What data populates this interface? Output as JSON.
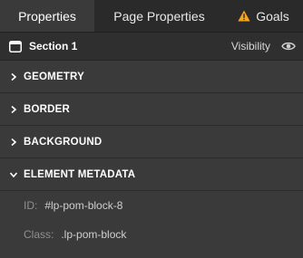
{
  "tabs": [
    {
      "label": "Properties"
    },
    {
      "label": "Page Properties"
    },
    {
      "label": "Goals"
    }
  ],
  "section": {
    "title": "Section 1",
    "visibility_label": "Visibility"
  },
  "accordion": [
    {
      "label": "GEOMETRY",
      "expanded": false
    },
    {
      "label": "BORDER",
      "expanded": false
    },
    {
      "label": "BACKGROUND",
      "expanded": false
    },
    {
      "label": "ELEMENT METADATA",
      "expanded": true
    }
  ],
  "metadata": {
    "id_label": "ID:",
    "id_value": "#lp-pom-block-8",
    "class_label": "Class:",
    "class_value": ".lp-pom-block"
  },
  "colors": {
    "background": "#3a3a3a",
    "tab_bar": "#2a2a2a",
    "warning": "#f5a623"
  },
  "icons": {
    "goals": "warning-icon",
    "section": "window-icon",
    "visibility": "eye-icon"
  }
}
